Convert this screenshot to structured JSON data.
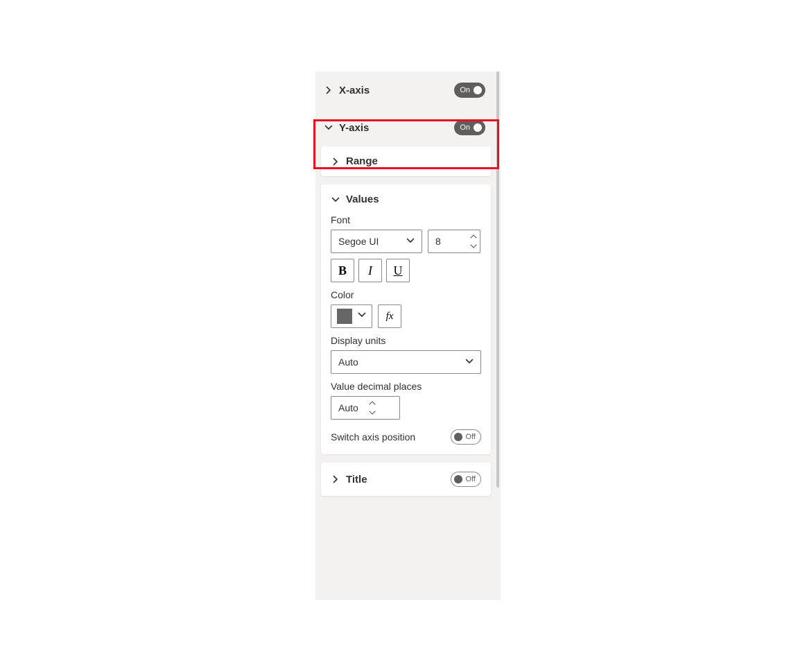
{
  "sections": {
    "x_axis": {
      "title": "X-axis",
      "toggle": "On",
      "expanded": false
    },
    "y_axis": {
      "title": "Y-axis",
      "toggle": "On",
      "expanded": true,
      "range": {
        "title": "Range",
        "expanded": false
      },
      "values": {
        "title": "Values",
        "expanded": true,
        "font_label": "Font",
        "font_family": "Segoe UI",
        "font_size": "8",
        "bold": "B",
        "italic": "I",
        "underline": "U",
        "color_label": "Color",
        "color_value": "#666666",
        "fx_label": "fx",
        "display_units_label": "Display units",
        "display_units_value": "Auto",
        "decimal_places_label": "Value decimal places",
        "decimal_places_value": "Auto",
        "switch_axis_label": "Switch axis position",
        "switch_axis_toggle": "Off"
      },
      "title_section": {
        "title": "Title",
        "toggle": "Off",
        "expanded": false
      }
    }
  }
}
